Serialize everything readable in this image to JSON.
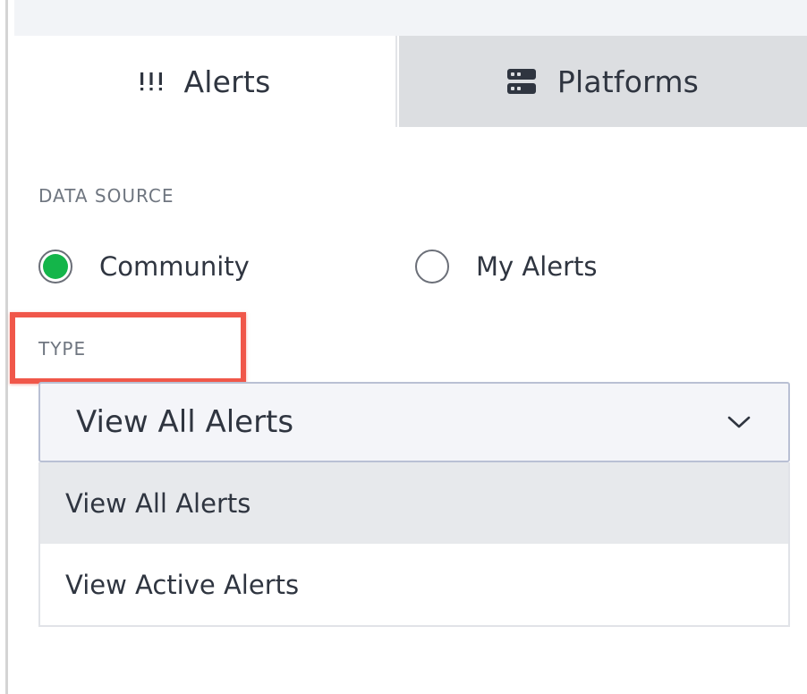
{
  "tabs": [
    {
      "label": "Alerts",
      "icon": "alerts-icon",
      "active": true
    },
    {
      "label": "Platforms",
      "icon": "server-icon",
      "active": false
    }
  ],
  "data_source": {
    "label": "DATA SOURCE",
    "options": [
      {
        "label": "Community",
        "selected": true
      },
      {
        "label": "My Alerts",
        "selected": false
      }
    ]
  },
  "type": {
    "label": "TYPE",
    "selected_value": "View All Alerts",
    "options": [
      {
        "label": "View All Alerts",
        "selected": true
      },
      {
        "label": "View Active Alerts",
        "selected": false
      }
    ]
  },
  "colors": {
    "radio_selected": "#14b54a",
    "highlight": "#f0574a",
    "inactive_tab": "#dcdee1"
  }
}
